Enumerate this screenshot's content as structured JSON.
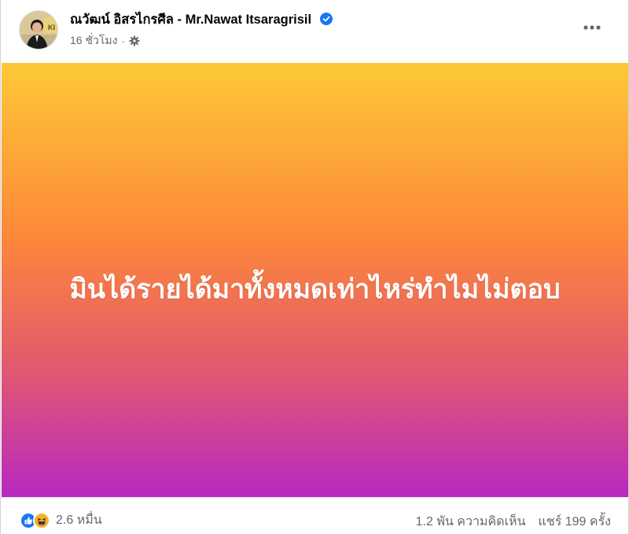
{
  "post": {
    "author_name": "ณวัฒน์ อิสรไกรศีล - Mr.Nawat Itsaragrisil",
    "timestamp": "16 ชั่วโมง",
    "separator": "·",
    "audience_icon": "gear-icon",
    "verified_icon": "verified-badge-icon",
    "more_icon": "more-options-icon",
    "body_text": "มินได้รายได้มาทั้งหมดเท่าไหร่ทำไมไม่ตอบ",
    "gradient_colors": [
      "#fdc938",
      "#fd8839",
      "#e2596f",
      "#b729c0"
    ]
  },
  "footer": {
    "reaction_icons": [
      "like-icon",
      "haha-icon"
    ],
    "reaction_count": "2.6 หมื่น",
    "comments": "1.2 พัน ความคิดเห็น",
    "shares": "แชร์ 199 ครั้ง"
  },
  "colors": {
    "verified": "#1877f2",
    "like": "#1877f2",
    "haha": "#f7b125",
    "secondary_text": "#65676b"
  }
}
